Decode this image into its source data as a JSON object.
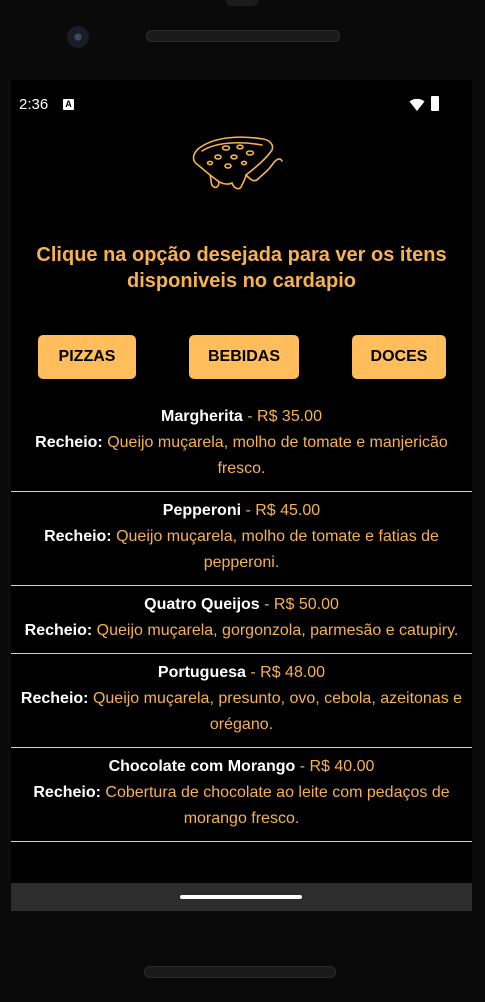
{
  "status_bar": {
    "time": "2:36",
    "notification_icon": "A"
  },
  "logo": {
    "icon": "pizza-slice-icon"
  },
  "headline": "Clique na opção desejada para ver os itens disponiveis no cardapio",
  "categories": [
    {
      "label": "PIZZAS"
    },
    {
      "label": "BEBIDAS"
    },
    {
      "label": "DOCES"
    }
  ],
  "items": [
    {
      "name": "Margherita",
      "price": " - R$ 35.00",
      "filling_label": "Recheio:",
      "filling": " Queijo muçarela, molho de tomate e manjericão fresco."
    },
    {
      "name": "Pepperoni",
      "price": " - R$ 45.00",
      "filling_label": "Recheio:",
      "filling": " Queijo muçarela, molho de tomate e fatias de pepperoni."
    },
    {
      "name": "Quatro Queijos",
      "price": " - R$ 50.00",
      "filling_label": "Recheio:",
      "filling": " Queijo muçarela, gorgonzola, parmesão e catupiry."
    },
    {
      "name": "Portuguesa",
      "price": " - R$ 48.00",
      "filling_label": "Recheio:",
      "filling": " Queijo muçarela, presunto, ovo, cebola, azeitonas e orégano."
    },
    {
      "name": "Chocolate com Morango",
      "price": " - R$ 40.00",
      "filling_label": "Recheio:",
      "filling": " Cobertura de chocolate ao leite com pedaços de morango fresco."
    }
  ],
  "colors": {
    "accent": "#f5b152",
    "button_bg": "#ffbd5c",
    "background": "#000000"
  }
}
